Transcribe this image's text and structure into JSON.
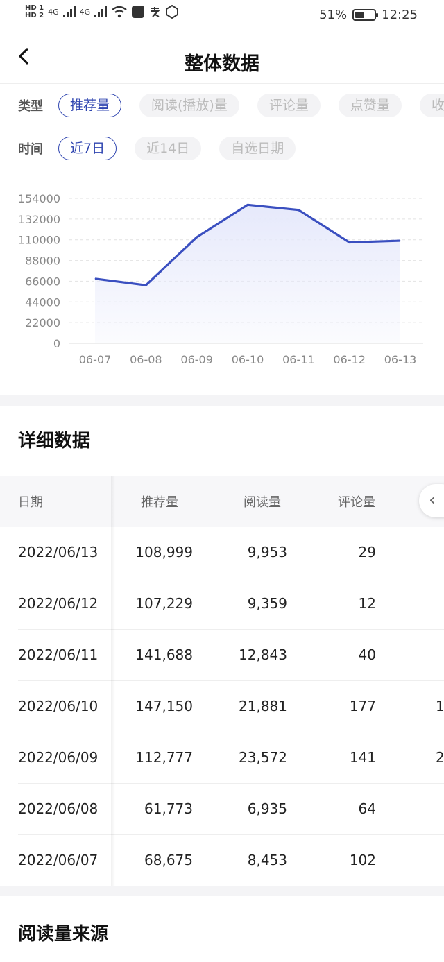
{
  "status": {
    "hd1": "HD 1",
    "hd2": "HD 2",
    "sig1": "4G",
    "sig2": "4G",
    "battery_text": "51%",
    "battery_level": 0.51,
    "time": "12:25"
  },
  "nav": {
    "title": "整体数据",
    "back_icon": "chevron-left-icon"
  },
  "filters": {
    "type_label": "类型",
    "type_options": [
      "推荐量",
      "阅读(播放)量",
      "评论量",
      "点赞量",
      "收"
    ],
    "type_selected": "推荐量",
    "time_label": "时间",
    "time_options": [
      "近7日",
      "近14日",
      "自选日期"
    ],
    "time_selected": "近7日"
  },
  "chart_data": {
    "type": "area",
    "x": [
      "06-07",
      "06-08",
      "06-09",
      "06-10",
      "06-11",
      "06-12",
      "06-13"
    ],
    "values": [
      68675,
      61773,
      112777,
      147150,
      141688,
      107229,
      108999
    ],
    "ylim": [
      0,
      154000
    ],
    "yticks": [
      0,
      22000,
      44000,
      66000,
      88000,
      110000,
      132000,
      154000
    ],
    "line_color": "#3a4fc0",
    "fill_color": "#e6e9fb",
    "grid": true
  },
  "detail": {
    "title": "详细数据",
    "columns": [
      "日期",
      "推荐量",
      "阅读量",
      "评论量"
    ],
    "rows": [
      [
        "2022/06/13",
        "108,999",
        "9,953",
        "29",
        ""
      ],
      [
        "2022/06/12",
        "107,229",
        "9,359",
        "12",
        ""
      ],
      [
        "2022/06/11",
        "141,688",
        "12,843",
        "40",
        ""
      ],
      [
        "2022/06/10",
        "147,150",
        "21,881",
        "177",
        "1"
      ],
      [
        "2022/06/09",
        "112,777",
        "23,572",
        "141",
        "2"
      ],
      [
        "2022/06/08",
        "61,773",
        "6,935",
        "64",
        ""
      ],
      [
        "2022/06/07",
        "68,675",
        "8,453",
        "102",
        ""
      ]
    ],
    "scroll_icon": "chevron-left-icon"
  },
  "source": {
    "title": "阅读量来源"
  }
}
